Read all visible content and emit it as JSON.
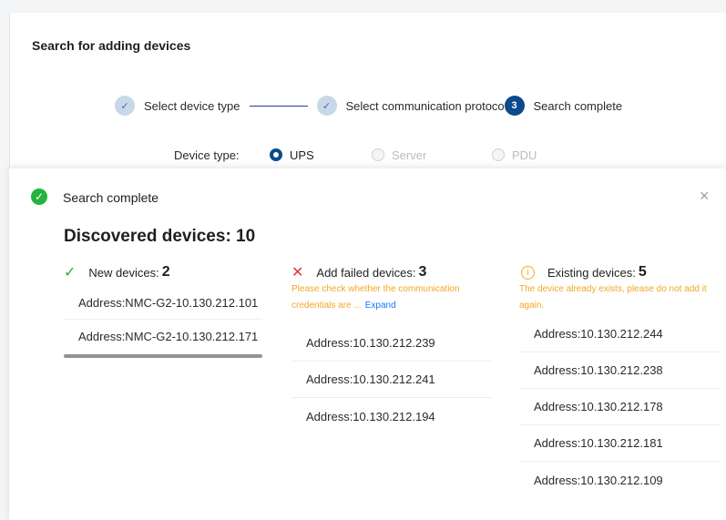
{
  "wizard": {
    "title": "Search for adding devices",
    "steps": [
      {
        "label": "Select device type",
        "marker": "✓",
        "state": "done"
      },
      {
        "label": "Select communication protocol",
        "marker": "✓",
        "state": "done"
      },
      {
        "label": "Search complete",
        "marker": "3",
        "state": "active"
      }
    ],
    "device_type": {
      "label": "Device type:",
      "options": [
        {
          "label": "UPS",
          "checked": true
        },
        {
          "label": "Server",
          "checked": false
        },
        {
          "label": "PDU",
          "checked": false
        }
      ]
    }
  },
  "result": {
    "title": "Search complete",
    "close": "×",
    "discovered": "Discovered devices: 10",
    "new_devices": {
      "label": "New devices:",
      "count": "2",
      "items": [
        "Address:NMC-G2-10.130.212.101",
        "Address:NMC-G2-10.130.212.171"
      ]
    },
    "failed_devices": {
      "label": "Add failed devices:",
      "count": "3",
      "note": "Please check whether the communication credentials are ...",
      "expand": "Expand",
      "items": [
        "Address:10.130.212.239",
        "Address:10.130.212.241",
        "Address:10.130.212.194"
      ]
    },
    "existing_devices": {
      "label": "Existing devices:",
      "count": "5",
      "note": "The device already exists, please do not add it again.",
      "items": [
        "Address:10.130.212.244",
        "Address:10.130.212.238",
        "Address:10.130.212.178",
        "Address:10.130.212.181",
        "Address:10.130.212.109"
      ]
    }
  },
  "colors": {
    "accent": "#0c4a8c",
    "success": "#22b43c",
    "error": "#e0343a",
    "warning": "#f5a623",
    "link": "#1677ff"
  },
  "icons": [
    "check-icon",
    "success-icon",
    "close-icon",
    "cross-icon",
    "info-icon"
  ]
}
